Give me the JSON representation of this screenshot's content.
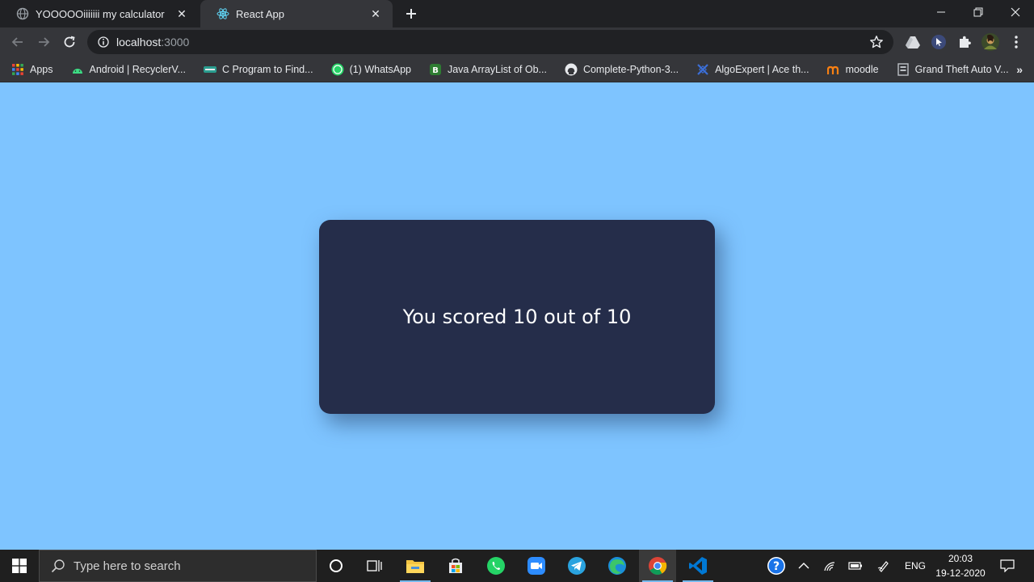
{
  "browser": {
    "tabs": [
      {
        "title": "YOOOOOiiiiiii my calculator",
        "icon": "globe-icon",
        "active": false
      },
      {
        "title": "React App",
        "icon": "react-icon",
        "active": true
      }
    ],
    "address": {
      "host": "localhost",
      "port": ":3000"
    },
    "bookmarks": [
      {
        "label": "Apps",
        "icon": "apps-grid-icon"
      },
      {
        "label": "Android | RecyclerV...",
        "icon": "android-icon"
      },
      {
        "label": "C Program to Find...",
        "icon": "site-icon"
      },
      {
        "label": "(1) WhatsApp",
        "icon": "whatsapp-icon"
      },
      {
        "label": "Java ArrayList of Ob...",
        "icon": "site-b-icon"
      },
      {
        "label": "Complete-Python-3...",
        "icon": "github-icon"
      },
      {
        "label": "AlgoExpert | Ace th...",
        "icon": "algoexpert-icon"
      },
      {
        "label": "moodle",
        "icon": "moodle-icon"
      },
      {
        "label": "Grand Theft Auto V...",
        "icon": "game-icon"
      }
    ],
    "bookmarks_more": "»"
  },
  "page": {
    "score_text": "You scored 10 out of 10"
  },
  "taskbar": {
    "search_placeholder": "Type here to search",
    "language": "ENG",
    "time": "20:03",
    "date": "19-12-2020",
    "apps": [
      "cortana-icon",
      "task-view-icon",
      "file-explorer-icon",
      "store-icon",
      "whatsapp-icon",
      "zoom-icon",
      "telegram-icon",
      "edge-icon",
      "chrome-icon",
      "vscode-icon"
    ]
  },
  "colors": {
    "page_background": "#7ec4ff",
    "card_background": "#252d4a",
    "browser_dark": "#202124",
    "browser_toolbar": "#35363a"
  }
}
